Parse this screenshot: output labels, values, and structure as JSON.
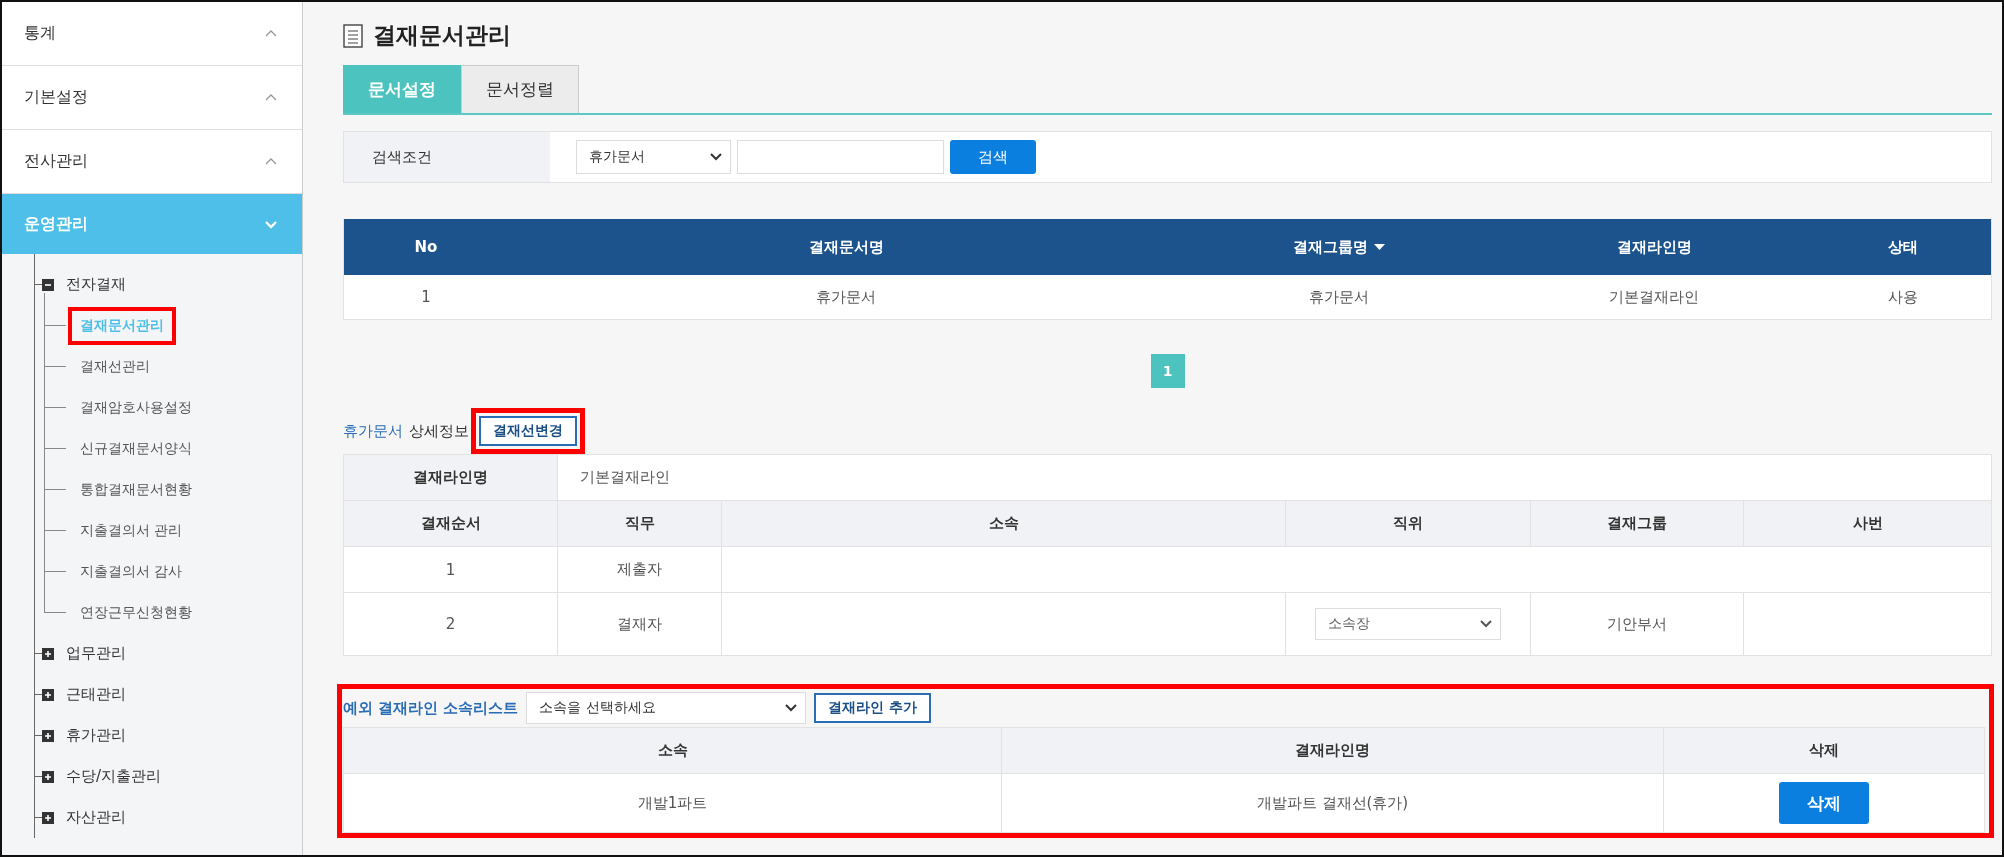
{
  "sidebar": {
    "menus": [
      {
        "label": "통계",
        "expanded": false
      },
      {
        "label": "기본설정",
        "expanded": false
      },
      {
        "label": "전사관리",
        "expanded": false
      },
      {
        "label": "운영관리",
        "expanded": true
      }
    ],
    "tree": [
      {
        "label": "전자결재",
        "expanded": true,
        "children": [
          {
            "label": "결재문서관리",
            "selected": true,
            "highlighted": true
          },
          {
            "label": "결재선관리",
            "selected": false,
            "highlighted": false
          },
          {
            "label": "결재암호사용설정",
            "selected": false,
            "highlighted": false
          },
          {
            "label": "신규결재문서양식",
            "selected": false,
            "highlighted": false
          },
          {
            "label": "통합결재문서현황",
            "selected": false,
            "highlighted": false
          },
          {
            "label": "지출결의서 관리",
            "selected": false,
            "highlighted": false
          },
          {
            "label": "지출결의서 감사",
            "selected": false,
            "highlighted": false
          },
          {
            "label": "연장근무신청현황",
            "selected": false,
            "highlighted": false
          }
        ]
      },
      {
        "label": "업무관리",
        "expanded": false
      },
      {
        "label": "근태관리",
        "expanded": false
      },
      {
        "label": "휴가관리",
        "expanded": false
      },
      {
        "label": "수당/지출관리",
        "expanded": false
      },
      {
        "label": "자산관리",
        "expanded": false
      }
    ]
  },
  "page_title": "결재문서관리",
  "tabs": [
    {
      "label": "문서설정",
      "selected": true
    },
    {
      "label": "문서정렬",
      "selected": false
    }
  ],
  "search": {
    "label": "검색조건",
    "select": "휴가문서",
    "button": "검색"
  },
  "table": {
    "columns": [
      {
        "label": "No",
        "sorted": false
      },
      {
        "label": "결재문서명",
        "sorted": false
      },
      {
        "label": "결재그룹명",
        "sorted": true
      },
      {
        "label": "결재라인명",
        "sorted": false
      },
      {
        "label": "상태",
        "sorted": false
      }
    ],
    "rows": [
      [
        "1",
        "휴가문서",
        "휴가문서",
        "기본결재라인",
        "사용"
      ]
    ]
  },
  "pagination": [
    {
      "label": "1",
      "selected": true
    }
  ],
  "detail": {
    "doc": "휴가문서",
    "suffix": "상세정보",
    "button": "결재선변경",
    "button_highlighted": true,
    "line_label": "결재라인명",
    "line_value": "기본결재라인",
    "columns": [
      "결재순서",
      "직무",
      "소속",
      "직위",
      "결재그룹",
      "사번"
    ],
    "rows": [
      {
        "order": "1",
        "duty": "제출자"
      },
      {
        "order": "2",
        "duty": "결재자",
        "position": "소속장",
        "group": "기안부서"
      }
    ]
  },
  "exceptions": {
    "highlighted": true,
    "title": "예외 결재라인 소속리스트",
    "select": "소속을 선택하세요",
    "add_button": "결재라인 추가",
    "columns": [
      "소속",
      "결재라인명",
      "삭제"
    ],
    "rows": [
      {
        "dept": "개발1파트",
        "line": "개발파트 결재선(휴가)",
        "button": "삭제"
      }
    ]
  }
}
